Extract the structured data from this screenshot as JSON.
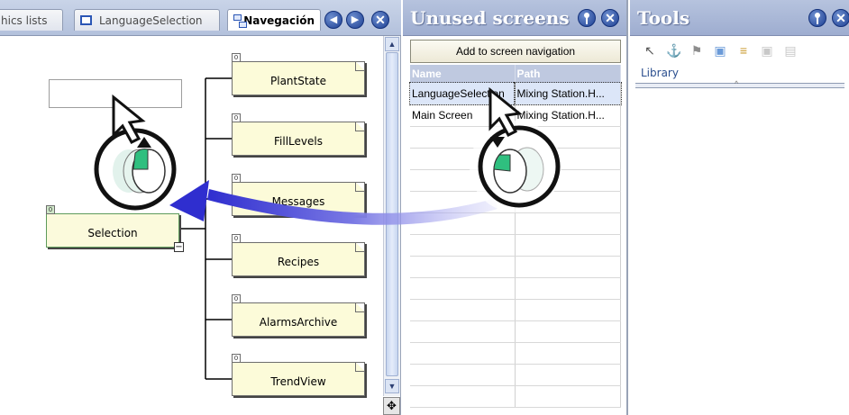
{
  "left_tabs": [
    {
      "label": "hics lists"
    },
    {
      "label": "LanguageSelection"
    },
    {
      "label": "Navegación"
    }
  ],
  "tab_nav": {
    "prev": "◀",
    "next": "▶",
    "close": "✕"
  },
  "navigation_tree": {
    "root": {
      "label": "Selection",
      "tag": "0",
      "collapse": "−"
    },
    "children": [
      {
        "label": "PlantState",
        "tag": "0"
      },
      {
        "label": "FillLevels",
        "tag": "0"
      },
      {
        "label": "Messages",
        "tag": "0"
      },
      {
        "label": "Recipes",
        "tag": "0"
      },
      {
        "label": "AlarmsArchive",
        "tag": "0"
      },
      {
        "label": "TrendView",
        "tag": "0"
      }
    ]
  },
  "scrollbar": {
    "up": "▲",
    "down": "▼",
    "move_handle": "✥"
  },
  "unused_screens": {
    "title": "Unused screens",
    "add_button": "Add to screen navigation",
    "columns": [
      "Name",
      "Path"
    ],
    "rows": [
      {
        "name": "LanguageSelection",
        "path": "Mixing Station.H...",
        "selected": true
      },
      {
        "name": "Main Screen",
        "path": "Mixing Station.H...",
        "selected": false
      }
    ]
  },
  "tools": {
    "title": "Tools",
    "toolbar_icons": [
      "pointer-icon",
      "stamp-icon",
      "pin-icon",
      "object-icon",
      "stack-icon",
      "disabled-object-icon",
      "disabled-stack-icon"
    ],
    "library_label": "Library",
    "splitter_grip": "^"
  },
  "colors": {
    "title_bar": "#a8b6d6",
    "drag_arrow": "#3b3ad0",
    "mouse_highlight": "#2fbf7f",
    "node_fill": "#fcfbd9"
  }
}
